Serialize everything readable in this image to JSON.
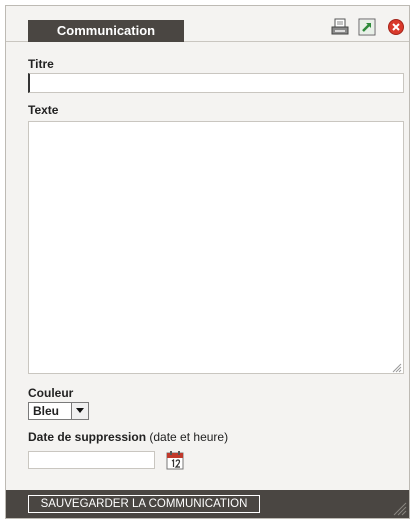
{
  "header": {
    "tab_label": "Communication",
    "icons": {
      "print": "print-icon",
      "popout": "popout-icon",
      "close": "close-icon"
    }
  },
  "form": {
    "titre_label": "Titre",
    "titre_value": "",
    "texte_label": "Texte",
    "texte_value": "",
    "couleur_label": "Couleur",
    "couleur_selected": "Bleu",
    "date_label": "Date de suppression",
    "date_hint": "(date et heure)",
    "date_value": "",
    "calendar_icon": "calendar-icon"
  },
  "footer": {
    "save_label": "SAUVEGARDER LA COMMUNICATION"
  },
  "colors": {
    "dark": "#4a4642",
    "panel": "#f4f3f1",
    "close_red": "#d9392b",
    "popout_green": "#2e8b3a"
  }
}
